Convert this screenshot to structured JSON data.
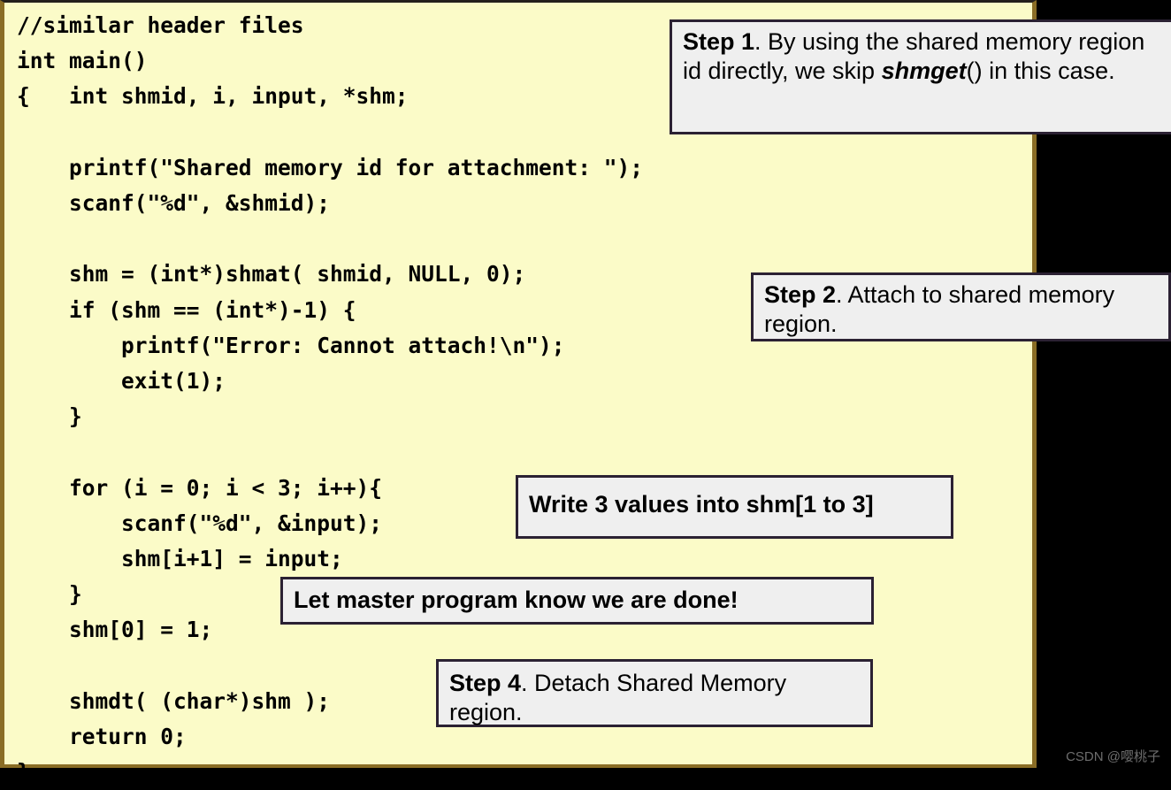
{
  "slide": {
    "background_color": "#000000",
    "panel_background_color": "#fbfbc8",
    "panel_border_color": "#8a6d25",
    "callout_background_color": "#efefef",
    "callout_border_color": "#2b2133"
  },
  "code": {
    "language": "c",
    "text": "//similar header files\nint main()\n{   int shmid, i, input, *shm;\n\n    printf(\"Shared memory id for attachment: \");\n    scanf(\"%d\", &shmid);\n\n    shm = (int*)shmat( shmid, NULL, 0);\n    if (shm == (int*)-1) {\n        printf(\"Error: Cannot attach!\\n\");\n        exit(1);\n    }\n\n    for (i = 0; i < 3; i++){\n        scanf(\"%d\", &input);\n        shm[i+1] = input;\n    }\n    shm[0] = 1;\n\n    shmdt( (char*)shm );\n    return 0;\n}"
  },
  "callouts": {
    "step1": {
      "label": "Step 1",
      "text_1": ". By using the shared memory region id directly, we skip ",
      "emphasis": "shmget",
      "text_2": "() in this case."
    },
    "step2": {
      "label": "Step 2",
      "text": ". Attach to shared memory region."
    },
    "write3": {
      "text": "Write 3 values into shm[1 to 3]"
    },
    "letmaster": {
      "text": "Let master program know we are done!"
    },
    "step4": {
      "label": "Step 4",
      "text": ". Detach Shared Memory region."
    }
  },
  "watermark": {
    "text": "CSDN @嘤桃子"
  }
}
